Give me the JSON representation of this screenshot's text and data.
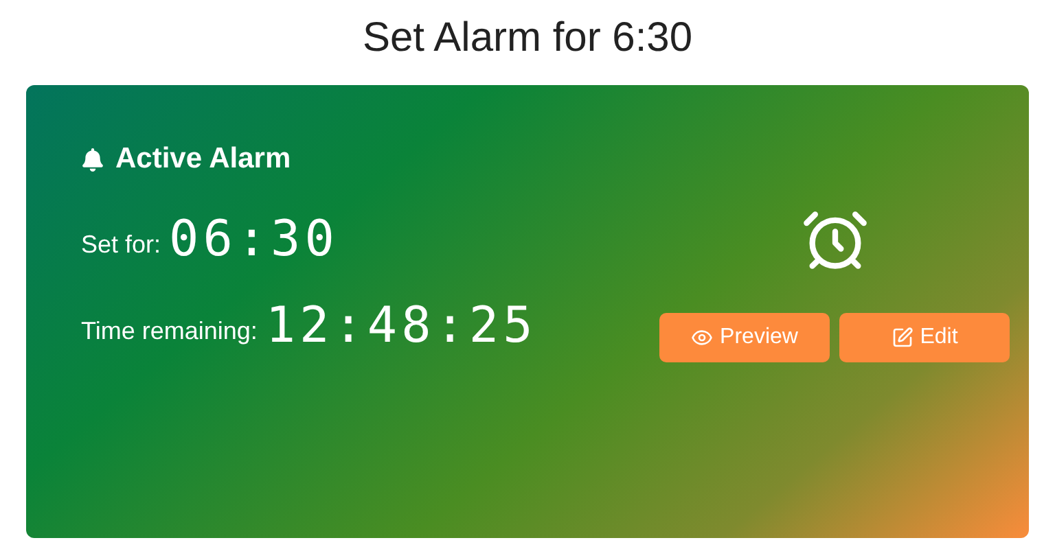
{
  "title": "Set Alarm for 6:30",
  "card": {
    "heading": "Active Alarm",
    "set_for": {
      "label": "Set for:",
      "value": "06:30"
    },
    "remaining": {
      "label": "Time remaining:",
      "value": "12:48:25"
    },
    "buttons": [
      {
        "kind": "preview",
        "label": "Preview"
      },
      {
        "kind": "edit",
        "label": "Edit"
      }
    ]
  }
}
